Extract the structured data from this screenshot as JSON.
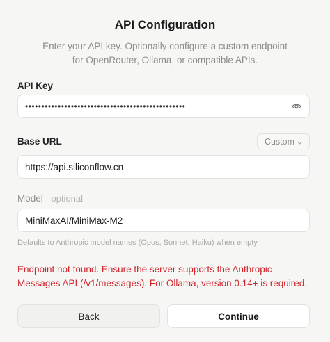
{
  "header": {
    "title": "API Configuration",
    "subtitle_line1": "Enter your API key. Optionally configure a custom endpoint",
    "subtitle_line2": "for OpenRouter, Ollama, or compatible APIs."
  },
  "api_key": {
    "label": "API Key",
    "masked_value": "•••••••••••••••••••••••••••••••••••••••••••••••••",
    "reveal_icon": "eye-icon"
  },
  "base_url": {
    "label": "Base URL",
    "preset_selected": "Custom",
    "value": "https://api.siliconflow.cn"
  },
  "model": {
    "label": "Model",
    "optional_tag": "· optional",
    "value": "MiniMaxAI/MiniMax-M2",
    "hint": "Defaults to Anthropic model names (Opus, Sonnet, Haiku) when empty"
  },
  "error": {
    "line1": "Endpoint not found. Ensure the server supports the Anthropic",
    "line2": "Messages API (/v1/messages). For Ollama, version 0.14+ is required.",
    "color": "#d1242b"
  },
  "actions": {
    "back_label": "Back",
    "continue_label": "Continue"
  }
}
